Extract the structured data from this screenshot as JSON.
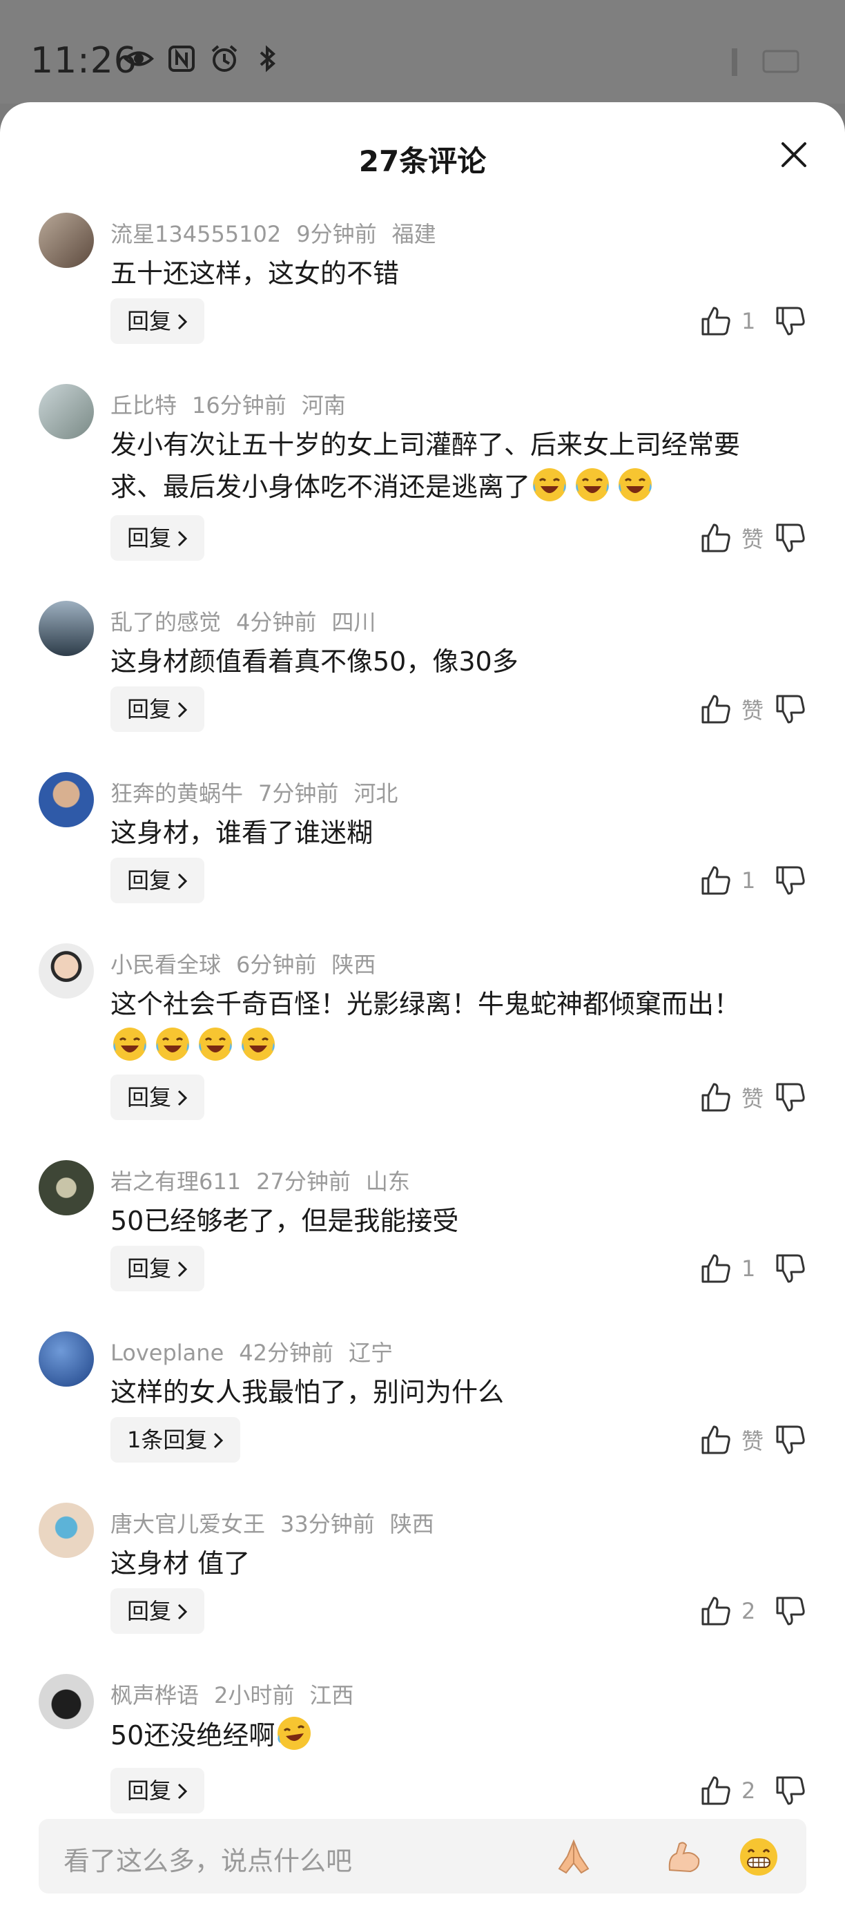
{
  "status": {
    "time": "11:26"
  },
  "sheet": {
    "title": "27条评论"
  },
  "comments": [
    {
      "user": "流星134555102",
      "time": "9分钟前",
      "location": "福建",
      "text": "五十还这样，这女的不错",
      "reply": "回复",
      "likes": "1",
      "avatar_color": "#7a6a5e"
    },
    {
      "user": "丘比特",
      "time": "16分钟前",
      "location": "河南",
      "text": "发小有次让五十岁的女上司灌醉了、后来女上司经常要求、最后发小身体吃不消还是逃离了",
      "reply": "回复",
      "likes": "赞",
      "avatar_color": "#9aa6a8"
    },
    {
      "user": "乱了的感觉",
      "time": "4分钟前",
      "location": "四川",
      "text": "这身材颜值看着真不像50，像30多",
      "reply": "回复",
      "likes": "赞",
      "avatar_color": "#5b6e7f"
    },
    {
      "user": "狂奔的黄蜗牛",
      "time": "7分钟前",
      "location": "河北",
      "text": "这身材，谁看了谁迷糊",
      "reply": "回复",
      "likes": "1",
      "avatar_color": "#2f5aa8"
    },
    {
      "user": "小民看全球",
      "time": "6分钟前",
      "location": "陕西",
      "text": "这个社会千奇百怪！光影绿离！牛鬼蛇神都倾窠而出！",
      "reply": "回复",
      "likes": "赞",
      "avatar_color": "#e8e6e2"
    },
    {
      "user": "岩之有理611",
      "time": "27分钟前",
      "location": "山东",
      "text": "50已经够老了，但是我能接受",
      "reply": "回复",
      "likes": "1",
      "avatar_color": "#4a5040"
    },
    {
      "user": "Loveplane",
      "time": "42分钟前",
      "location": "辽宁",
      "text": "这样的女人我最怕了，别问为什么",
      "reply": "1条回复",
      "likes": "赞",
      "avatar_color": "#2d5aa6"
    },
    {
      "user": "唐大官儿爱女王",
      "time": "33分钟前",
      "location": "陕西",
      "text": "这身材 值了",
      "reply": "回复",
      "likes": "2",
      "avatar_color": "#e7d3c0"
    },
    {
      "user": "枫声桦语",
      "time": "2小时前",
      "location": "江西",
      "text": "50还没绝经啊",
      "reply": "回复",
      "likes": "2",
      "avatar_color": "#3a3a3a"
    }
  ],
  "input": {
    "placeholder": "看了这么多，说点什么吧"
  },
  "icons": {
    "close": "close-icon",
    "like": "thumb-up-icon",
    "dislike": "thumb-down-icon",
    "laugh": "laughing-crying-emoji",
    "pray": "folded-hands-emoji",
    "muscle": "flexed-biceps-emoji",
    "grin": "grinning-emoji"
  }
}
